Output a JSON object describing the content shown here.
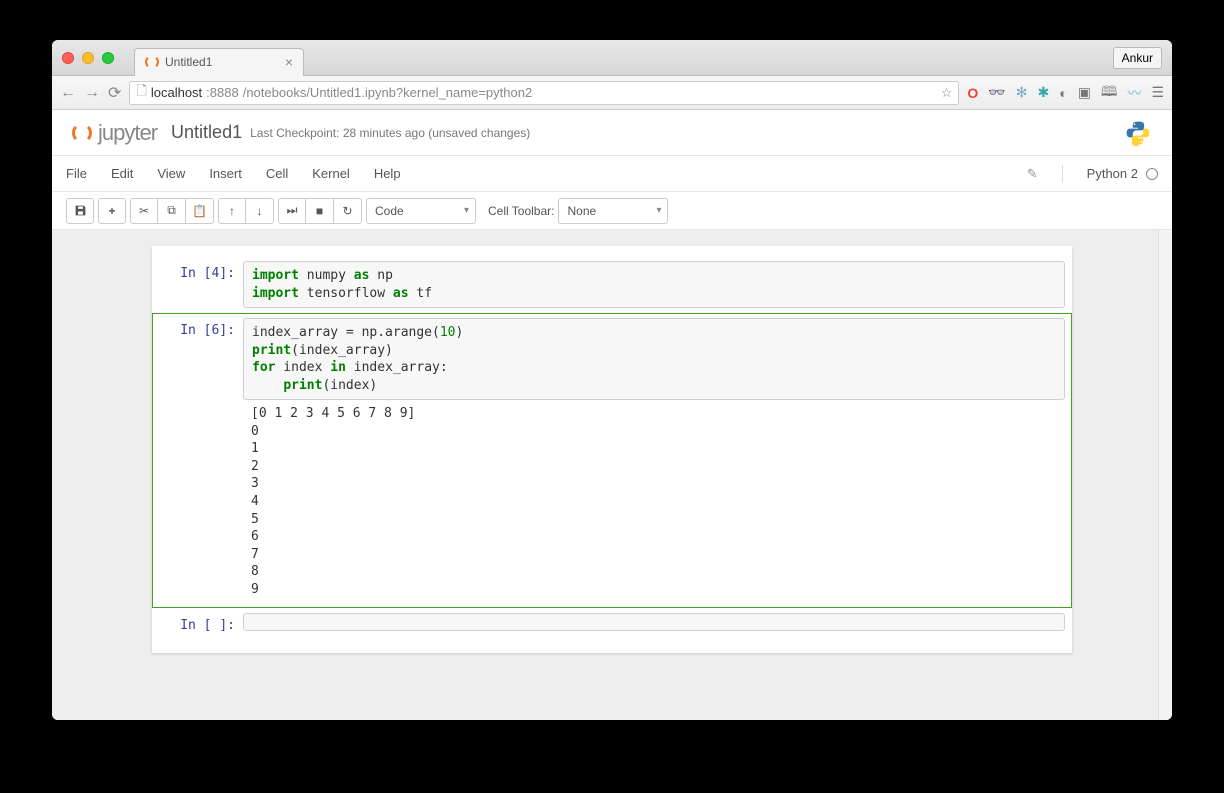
{
  "browser": {
    "tab_title": "Untitled1",
    "profile": "Ankur",
    "url_host": "localhost",
    "url_port": ":8888",
    "url_path": "/notebooks/Untitled1.ipynb?kernel_name=python2"
  },
  "header": {
    "logo_text": "jupyter",
    "notebook_name": "Untitled1",
    "checkpoint": "Last Checkpoint: 28 minutes ago (unsaved changes)"
  },
  "menu": {
    "items": [
      "File",
      "Edit",
      "View",
      "Insert",
      "Cell",
      "Kernel",
      "Help"
    ],
    "kernel": "Python 2"
  },
  "toolbar": {
    "cell_type": "Code",
    "cell_toolbar_label": "Cell Toolbar:",
    "cell_toolbar_value": "None"
  },
  "cells": [
    {
      "prompt": "In [4]:",
      "code_html": "<span class='kw'>import</span> numpy <span class='kw'>as</span> np\n<span class='kw'>import</span> tensorflow <span class='kw'>as</span> tf"
    },
    {
      "prompt": "In [6]:",
      "code_html": "index_array = np.arange(<span class='num'>10</span>)\n<span class='kw'>print</span>(index_array)\n<span class='kw'>for</span> index <span class='kw'>in</span> index_array:\n    <span class='kw'>print</span>(index)",
      "output": "[0 1 2 3 4 5 6 7 8 9]\n0\n1\n2\n3\n4\n5\n6\n7\n8\n9"
    },
    {
      "prompt": "In [ ]:",
      "code_html": ""
    }
  ]
}
